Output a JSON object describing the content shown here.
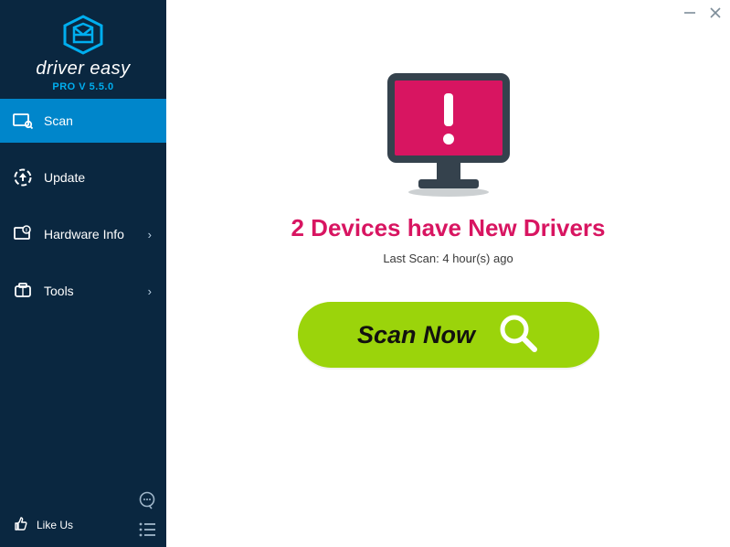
{
  "app": {
    "name": "driver easy",
    "version_label": "PRO V 5.5.0"
  },
  "sidebar": {
    "items": [
      {
        "label": "Scan",
        "active": true,
        "has_submenu": false
      },
      {
        "label": "Update",
        "active": false,
        "has_submenu": false
      },
      {
        "label": "Hardware Info",
        "active": false,
        "has_submenu": true
      },
      {
        "label": "Tools",
        "active": false,
        "has_submenu": true
      }
    ],
    "like_label": "Like Us"
  },
  "main": {
    "headline": "2 Devices have New Drivers",
    "last_scan": "Last Scan: 4 hour(s) ago",
    "scan_button": "Scan Now"
  },
  "colors": {
    "sidebar_bg": "#0a2740",
    "active_bg": "#0086cb",
    "accent_pink": "#d81561",
    "scan_green": "#9bd40b",
    "brand_blue": "#00aeef"
  }
}
